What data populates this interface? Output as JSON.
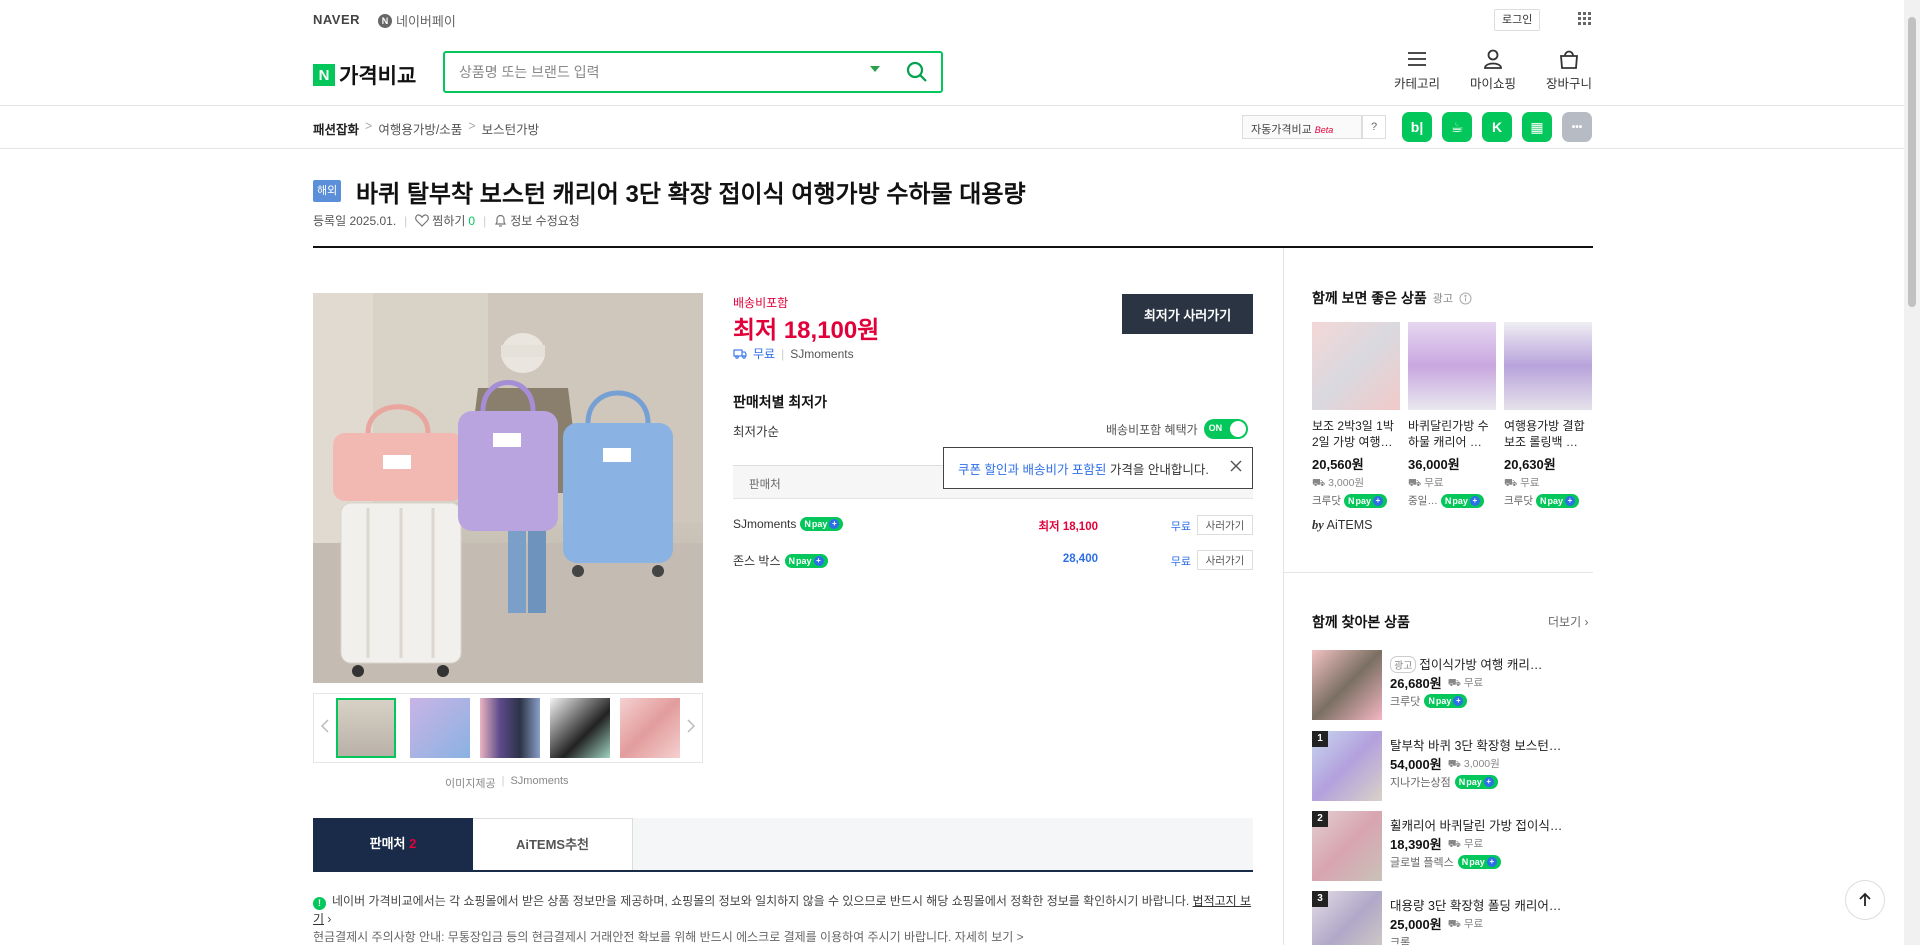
{
  "topbar": {
    "naver": "NAVER",
    "npay_label": "네이버페이",
    "npay_icon": "N",
    "login": "로그인"
  },
  "header": {
    "brand_n": "N",
    "brand_text": "가격비교",
    "search_placeholder": "상품명 또는 브랜드 입력",
    "nav": [
      {
        "label": "카테고리",
        "icon": "menu-icon"
      },
      {
        "label": "마이쇼핑",
        "icon": "person-icon"
      },
      {
        "label": "장바구니",
        "icon": "bag-icon"
      }
    ]
  },
  "breadcrumb": {
    "root": "패션잡화",
    "sep": ">",
    "level2": "여행용가방/소품",
    "level3": "보스턴가방"
  },
  "autocompare": {
    "label": "자동가격비교",
    "beta": "Beta",
    "help": "?"
  },
  "share": [
    {
      "name": "blog",
      "glyph": "b|",
      "color": "#03c75a"
    },
    {
      "name": "cafe",
      "glyph": "☕",
      "color": "#03c75a"
    },
    {
      "name": "keep",
      "glyph": "K",
      "color": "#03c75a"
    },
    {
      "name": "modoo",
      "glyph": "▦",
      "color": "#03c75a"
    },
    {
      "name": "more",
      "glyph": "•••",
      "color": "#b7bcc4"
    }
  ],
  "product": {
    "badge": "해외",
    "title": "바퀴 탈부착 보스턴 캐리어 3단 확장 접이식 여행가방 수하물 대용량",
    "registered": "등록일 2025.01.",
    "wish_label": "찜하기",
    "wish_count": "0",
    "edit_request": "정보 수정요청",
    "image_source_label": "이미지제공",
    "image_source": "SJmoments"
  },
  "price": {
    "shipping_included": "배송비포함",
    "lowest": "최저 18,100원",
    "free": "무료",
    "seller": "SJmoments",
    "buy_button": "최저가 사러가기"
  },
  "sellers": {
    "heading": "판매처별 최저가",
    "sort": "최저가순",
    "benefit": "배송비포함 혜택가",
    "toggle": "ON",
    "table_head": "판매처",
    "tooltip_blue": "쿠폰 할인과 배송비가 포함된",
    "tooltip_rest": " 가격을 안내합니다.",
    "rows": [
      {
        "name": "SJmoments",
        "price": "최저 18,100",
        "ship": "무료",
        "go": "사러가기",
        "lowest": true
      },
      {
        "name": "존스 박스",
        "price": "28,400",
        "ship": "무료",
        "go": "사러가기",
        "lowest": false
      }
    ],
    "npay": "pay"
  },
  "tabs": {
    "sellers": "판매처",
    "sellers_count": "2",
    "aitems": "AiTEMS추천"
  },
  "notice": {
    "bang": "!",
    "text": "네이버 가격비교에서는 각 쇼핑몰에서 받은 상품 정보만을 제공하며, 쇼핑몰의 정보와 일치하지 않을 수 있으므로 반드시 해당 쇼핑몰에서 정확한 정보를 확인하시기 바랍니다.",
    "link": "법적고지 보기",
    "line2": "현금결제시 주의사항 안내: 무통장입금 등의 현금결제시 거래안전 확보를 위해 반드시 에스크로 결제를 이용하여 주시기 바랍니다. 자세히 보기 >"
  },
  "recommend": {
    "heading": "함께 보면 좋은 상품",
    "ad": "광고",
    "items": [
      {
        "title": "보조 2박3일 1박2일 가방 여행…",
        "price": "20,560원",
        "ship": "3,000원",
        "mall": "크루닷"
      },
      {
        "title": "바퀴달린가방 수하물 캐리어 …",
        "price": "36,000원",
        "ship": "무료",
        "mall": "중일…"
      },
      {
        "title": "여행용가방 결합 보조 롤링백 …",
        "price": "20,630원",
        "ship": "무료",
        "mall": "크루닷"
      }
    ],
    "by": "by",
    "aitems": "AiTEMS"
  },
  "viewed": {
    "heading": "함께 찾아본 상품",
    "more": "더보기",
    "items": [
      {
        "rank": "",
        "ad": "광고",
        "title": "접이식가방 여행 캐리…",
        "price": "26,680원",
        "ship": "무료",
        "mall": "크루닷"
      },
      {
        "rank": "1",
        "ad": "",
        "title": "탈부착 바퀴 3단 확장형 보스턴…",
        "price": "54,000원",
        "ship": "3,000원",
        "mall": "지나가는상점"
      },
      {
        "rank": "2",
        "ad": "",
        "title": "휠캐리어 바퀴달린 가방 접이식…",
        "price": "18,390원",
        "ship": "무료",
        "mall": "글로벌 플렉스"
      },
      {
        "rank": "3",
        "ad": "",
        "title": "대용량 3단 확장형 폴딩 캐리어…",
        "price": "25,000원",
        "ship": "무료",
        "mall": "크롬"
      }
    ]
  },
  "colors": {
    "brand": "#03c75a",
    "price": "#e1003a",
    "navy": "#1a2b4a",
    "link": "#2e6fe8"
  }
}
